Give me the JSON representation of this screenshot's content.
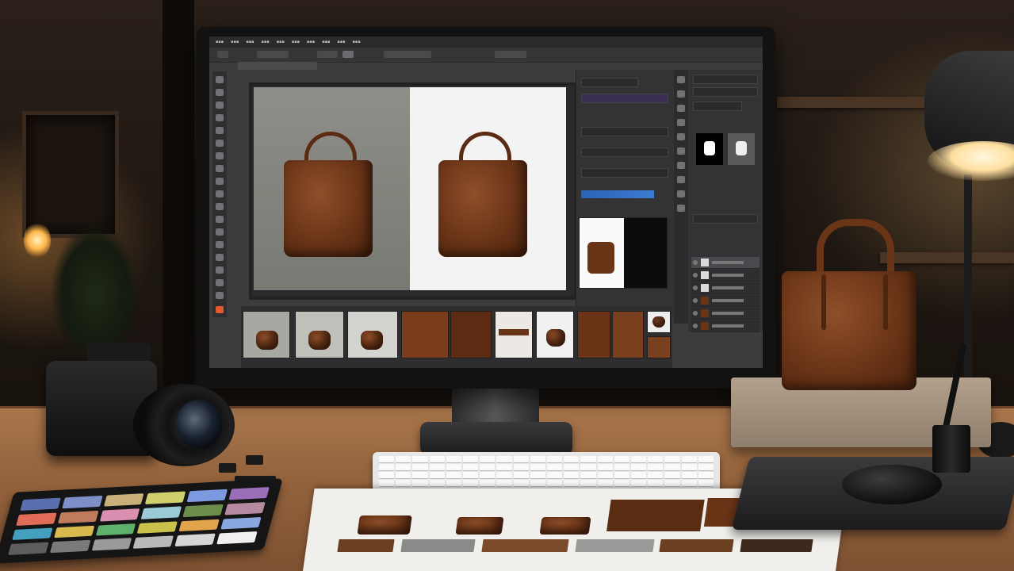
{
  "scene": {
    "description_free": true,
    "palette": {
      "leather": "#6a3417",
      "leather_dark": "#4a220d",
      "desk_wood": "#a9764c",
      "screen_ui": "#3c3c3e",
      "accent_blue": "#2b63b5",
      "foreground_swatch": "#e25a2e"
    }
  },
  "app": {
    "menu_items": [
      "",
      "",
      "",
      "",
      "",
      "",
      "",
      "",
      "",
      "",
      "",
      ""
    ]
  },
  "colorchecker": {
    "swatches": [
      "#5b6fb0",
      "#7e8fc7",
      "#c9b07a",
      "#cfd06d",
      "#7b9adf",
      "#9a6fb8",
      "#e06b57",
      "#c07a5d",
      "#d88fb0",
      "#9bc9d6",
      "#6b8e4a",
      "#b58aa0",
      "#45a0c0",
      "#d7b94e",
      "#5fb06b",
      "#c9c14c",
      "#e2a44a",
      "#8aa8e0",
      "#5d5d5d",
      "#7a7a7a",
      "#9a9a9a",
      "#b9b9b9",
      "#d6d6d6",
      "#f0f0f0"
    ]
  },
  "filmstrip": {
    "thumbs": [
      "bag-front-gray",
      "bag-front-light",
      "bag-front-light",
      "leather-detail",
      "buckle-detail",
      "strap-detail",
      "bag-white",
      "leather-closeup",
      "bag-small",
      "bag-stack"
    ]
  }
}
